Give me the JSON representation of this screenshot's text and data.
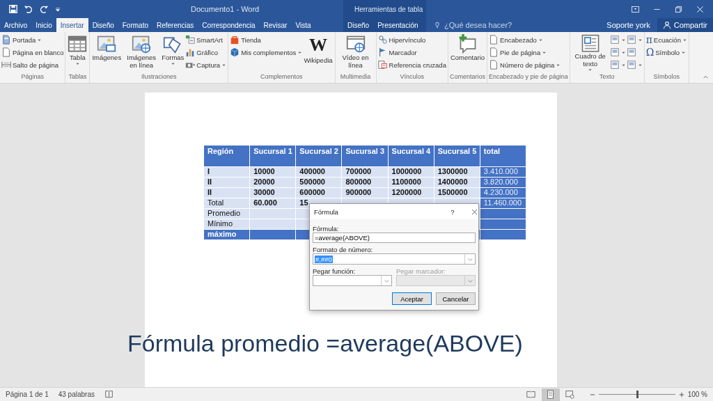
{
  "window": {
    "title": "Documento1 - Word",
    "context_title": "Herramientas de tabla"
  },
  "tabs": [
    {
      "label": "Archivo",
      "selected": false
    },
    {
      "label": "Inicio",
      "selected": false
    },
    {
      "label": "Insertar",
      "selected": true
    },
    {
      "label": "Diseño",
      "selected": false
    },
    {
      "label": "Formato",
      "selected": false
    },
    {
      "label": "Referencias",
      "selected": false
    },
    {
      "label": "Correspondencia",
      "selected": false
    },
    {
      "label": "Revisar",
      "selected": false
    },
    {
      "label": "Vista",
      "selected": false
    }
  ],
  "contextual_tabs": [
    {
      "label": "Diseño",
      "selected": false
    },
    {
      "label": "Presentación",
      "selected": false
    }
  ],
  "search": {
    "placeholder": "¿Qué desea hacer?"
  },
  "user": "Soporte york",
  "share_button": "Compartir",
  "ribbon": [
    {
      "label": "Páginas",
      "columns": [
        {
          "kind": "stack",
          "items": [
            {
              "label": "Portada",
              "dropdown": true
            },
            {
              "label": "Página en blanco",
              "dropdown": false
            },
            {
              "label": "Salto de página",
              "dropdown": false
            }
          ]
        }
      ]
    },
    {
      "label": "Tablas",
      "columns": [
        {
          "kind": "large",
          "label": "Tabla",
          "dropdown": true
        }
      ]
    },
    {
      "label": "Ilustraciones",
      "columns": [
        {
          "kind": "large",
          "label": "Imágenes",
          "dropdown": false
        },
        {
          "kind": "large",
          "label": "Imágenes en línea",
          "dropdown": false
        },
        {
          "kind": "large",
          "label": "Formas",
          "dropdown": true
        },
        {
          "kind": "stack",
          "items": [
            {
              "label": "SmartArt",
              "dropdown": false
            },
            {
              "label": "Gráfico",
              "dropdown": false
            },
            {
              "label": "Captura",
              "dropdown": true
            }
          ]
        }
      ]
    },
    {
      "label": "Complementos",
      "columns": [
        {
          "kind": "stack",
          "items": [
            {
              "label": "Tienda",
              "dropdown": false
            },
            {
              "label": "Mis complementos",
              "dropdown": true
            }
          ]
        },
        {
          "kind": "large",
          "label": "Wikipedia",
          "glyph": "W",
          "dropdown": false
        }
      ]
    },
    {
      "label": "Multimedia",
      "columns": [
        {
          "kind": "large",
          "label": "Vídeo en línea",
          "dropdown": false
        }
      ]
    },
    {
      "label": "Vínculos",
      "columns": [
        {
          "kind": "stack",
          "items": [
            {
              "label": "Hipervínculo",
              "dropdown": false
            },
            {
              "label": "Marcador",
              "dropdown": false
            },
            {
              "label": "Referencia cruzada",
              "dropdown": false
            }
          ]
        }
      ]
    },
    {
      "label": "Comentarios",
      "columns": [
        {
          "kind": "large",
          "label": "Comentario",
          "dropdown": false
        }
      ]
    },
    {
      "label": "Encabezado y pie de página",
      "columns": [
        {
          "kind": "stack",
          "items": [
            {
              "label": "Encabezado",
              "dropdown": true
            },
            {
              "label": "Pie de página",
              "dropdown": true
            },
            {
              "label": "Número de página",
              "dropdown": true
            }
          ]
        }
      ]
    },
    {
      "label": "Texto",
      "columns": [
        {
          "kind": "large",
          "label": "Cuadro de texto",
          "dropdown": true
        },
        {
          "kind": "stack",
          "items": [
            {
              "dropdown": true
            },
            {
              "dropdown": true
            },
            {
              "dropdown": true
            }
          ]
        },
        {
          "kind": "stack",
          "items": [
            {
              "dropdown": true
            },
            {
              "dropdown": false
            },
            {
              "dropdown": true
            }
          ]
        }
      ]
    },
    {
      "label": "Símbolos",
      "columns": [
        {
          "kind": "stack",
          "items": [
            {
              "label": "Ecuación",
              "glyph": "π",
              "dropdown": true
            },
            {
              "label": "Símbolo",
              "glyph": "Ω",
              "dropdown": true
            }
          ]
        }
      ]
    }
  ],
  "table": {
    "rows": [
      {
        "kind": "header",
        "cells": [
          {
            "text": "Región",
            "bold": true
          },
          {
            "text": "Sucursal 1",
            "bold": true
          },
          {
            "text": "Sucursal 2",
            "bold": true
          },
          {
            "text": "Sucursal 3",
            "bold": true
          },
          {
            "text": "Sucursal 4",
            "bold": true
          },
          {
            "text": "Sucursal 5",
            "bold": true
          },
          {
            "text": "total",
            "bold": true
          }
        ]
      },
      {
        "kind": "body",
        "cells": [
          {
            "text": "I",
            "bold": true
          },
          {
            "text": "10000",
            "bold": true
          },
          {
            "text": "400000",
            "bold": true
          },
          {
            "text": "700000",
            "bold": true
          },
          {
            "text": "1000000",
            "bold": true
          },
          {
            "text": "1300000",
            "bold": true
          },
          {
            "text": "3.410.000",
            "bold": false
          }
        ]
      },
      {
        "kind": "body",
        "cells": [
          {
            "text": "II",
            "bold": true
          },
          {
            "text": "20000",
            "bold": true
          },
          {
            "text": "500000",
            "bold": true
          },
          {
            "text": "800000",
            "bold": true
          },
          {
            "text": "1100000",
            "bold": true
          },
          {
            "text": "1400000",
            "bold": true
          },
          {
            "text": "3.820.000",
            "bold": false
          }
        ]
      },
      {
        "kind": "body",
        "cells": [
          {
            "text": "II",
            "bold": true
          },
          {
            "text": "30000",
            "bold": true
          },
          {
            "text": "600000",
            "bold": true
          },
          {
            "text": "900000",
            "bold": true
          },
          {
            "text": "1200000",
            "bold": true
          },
          {
            "text": "1500000",
            "bold": true
          },
          {
            "text": "4.230.000",
            "bold": false
          }
        ]
      },
      {
        "kind": "body",
        "cells": [
          {
            "text": "Total",
            "bold": false
          },
          {
            "text": "60.000",
            "bold": true
          },
          {
            "text": "15",
            "bold": true
          },
          {},
          {},
          {},
          {
            "text": "11.460.000",
            "bold": false
          }
        ]
      },
      {
        "kind": "body",
        "cells": [
          {
            "text": "Promedio",
            "bold": false
          },
          {},
          {},
          {},
          {},
          {},
          {}
        ]
      },
      {
        "kind": "body",
        "cells": [
          {
            "text": "Mínimo",
            "bold": false
          },
          {},
          {},
          {},
          {},
          {},
          {}
        ]
      },
      {
        "kind": "header",
        "cells": [
          {
            "text": "máximo",
            "bold": true
          },
          {},
          {},
          {},
          {},
          {},
          {}
        ]
      }
    ]
  },
  "caption": "Fórmula promedio =average(ABOVE)",
  "dialog": {
    "title": "Fórmula",
    "help": "?",
    "formula": {
      "label": "Fórmula:",
      "value": "=average(ABOVE)"
    },
    "number_format": {
      "label": "Formato de número:",
      "value": "#,##0",
      "value_selected": true
    },
    "combos": [
      {
        "label": "Pegar función:",
        "disabled": false
      },
      {
        "label": "Pegar marcador:",
        "disabled": true
      }
    ],
    "buttons": [
      {
        "label": "Aceptar",
        "default": true
      },
      {
        "label": "Cancelar",
        "default": false
      }
    ]
  },
  "status_bar": {
    "page": "Página 1 de 1",
    "words": "43 palabras",
    "views": [
      {
        "selected": false
      },
      {
        "selected": true
      },
      {
        "selected": false
      }
    ],
    "zoom": {
      "level": 0.5,
      "reading": "100 %"
    }
  }
}
